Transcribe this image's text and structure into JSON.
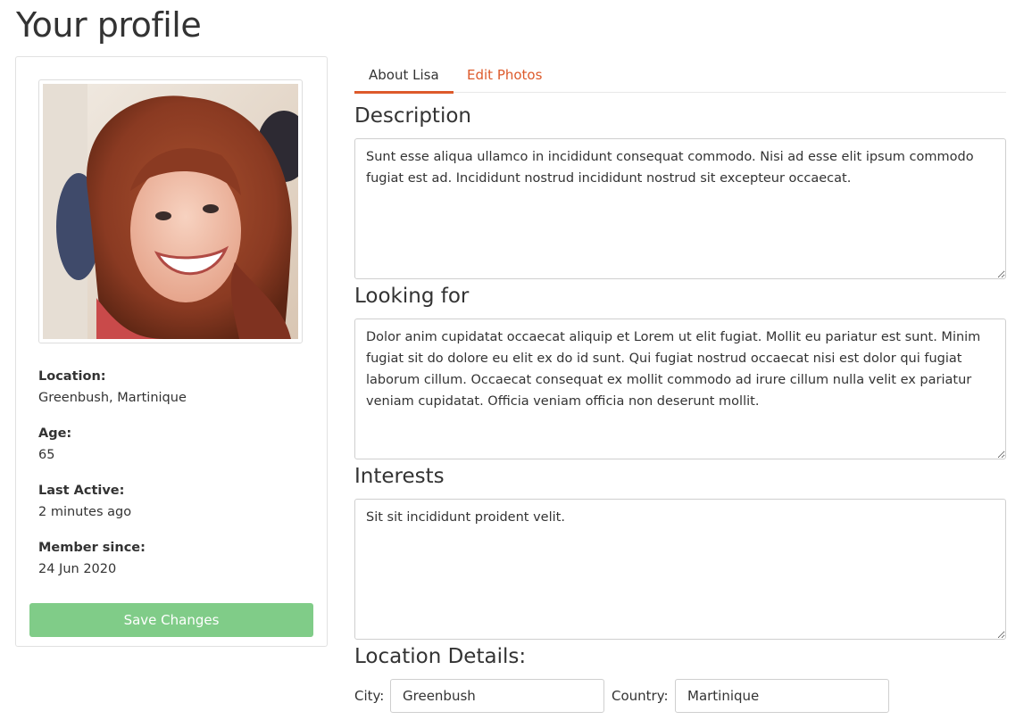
{
  "page": {
    "title": "Your profile"
  },
  "profile": {
    "photo_alt": "Profile photo",
    "info": [
      {
        "label": "Location:",
        "value": "Greenbush, Martinique"
      },
      {
        "label": "Age:",
        "value": "65"
      },
      {
        "label": "Last Active:",
        "value": "2 minutes ago"
      },
      {
        "label": "Member since:",
        "value": "24 Jun 2020"
      }
    ],
    "save_label": "Save Changes"
  },
  "tabs": [
    {
      "label": "About Lisa",
      "active": true
    },
    {
      "label": "Edit Photos",
      "active": false
    }
  ],
  "sections": {
    "description": {
      "heading": "Description",
      "text": "Sunt esse aliqua ullamco in incididunt consequat commodo. Nisi ad esse elit ipsum commodo fugiat est ad. Incididunt nostrud incididunt nostrud sit excepteur occaecat."
    },
    "looking_for": {
      "heading": "Looking for",
      "text": "Dolor anim cupidatat occaecat aliquip et Lorem ut elit fugiat. Mollit eu pariatur est sunt. Minim fugiat sit do dolore eu elit ex do id sunt. Qui fugiat nostrud occaecat nisi est dolor qui fugiat laborum cillum. Occaecat consequat ex mollit commodo ad irure cillum nulla velit ex pariatur veniam cupidatat. Officia veniam officia non deserunt mollit."
    },
    "interests": {
      "heading": "Interests",
      "text": "Sit sit incididunt proident velit."
    }
  },
  "location_details": {
    "heading": "Location Details:",
    "city_label": "City:",
    "city_value": "Greenbush",
    "country_label": "Country:",
    "country_value": "Martinique"
  },
  "colors": {
    "accent": "#dd5a2b",
    "save_button": "#80cc88",
    "border": "#cfcfcf"
  }
}
